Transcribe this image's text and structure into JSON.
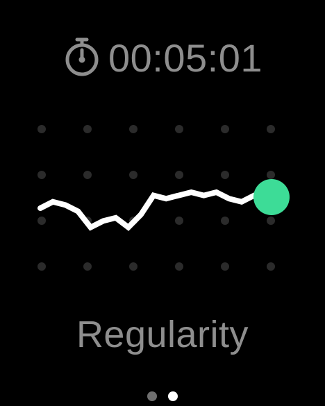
{
  "timer": {
    "icon": "stopwatch-icon",
    "elapsed": "00:05:01"
  },
  "graph": {
    "icon_marker": "current-position-dot",
    "trace": [
      0,
      2,
      1,
      -1,
      -6,
      -4,
      -3,
      -6,
      -2,
      4,
      3,
      4,
      5,
      4,
      5,
      3,
      2,
      4
    ]
  },
  "metric": {
    "label": "Regularity"
  },
  "pager": {
    "page_count": 2,
    "current_page": 2
  },
  "colors": {
    "text": "#8e8e8e",
    "grid_dot": "#2b2b2b",
    "trace": "#ffffff",
    "accent": "#3ddc97",
    "dot_inactive": "#6f6f6f",
    "dot_active": "#ffffff"
  }
}
